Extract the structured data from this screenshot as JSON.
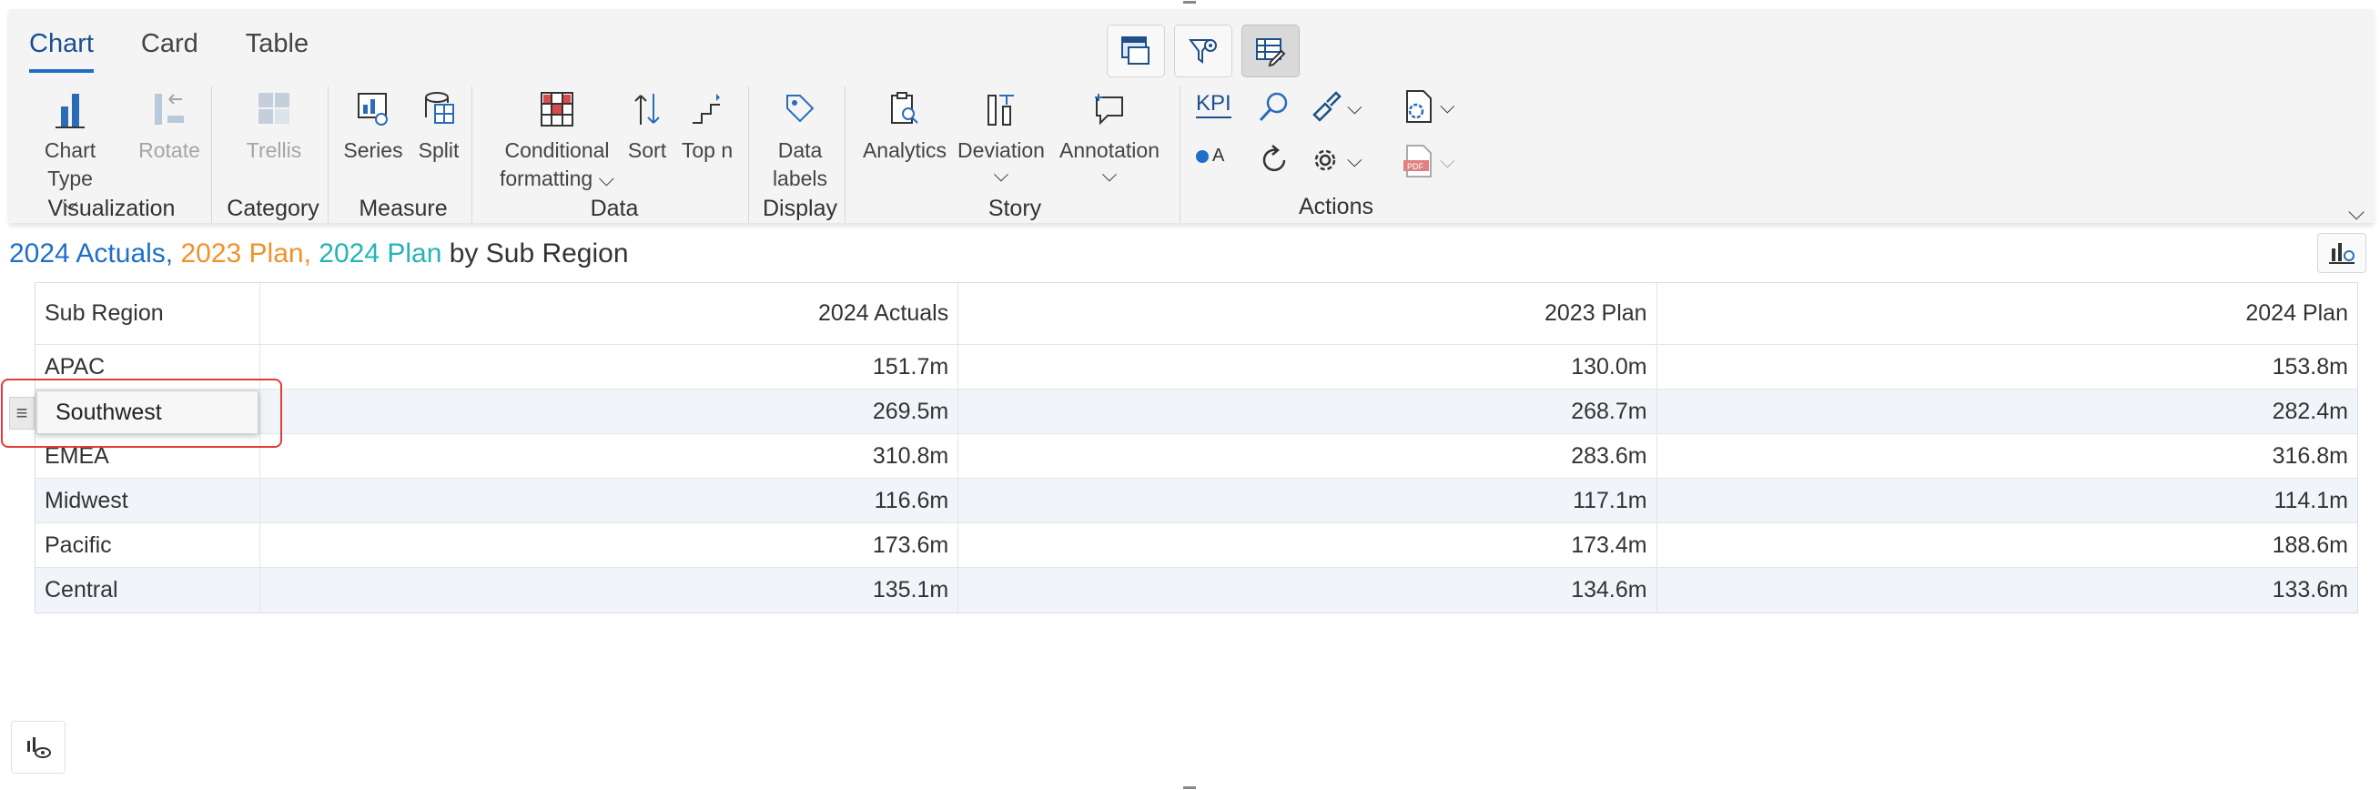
{
  "tabs": [
    {
      "label": "Chart",
      "active": true
    },
    {
      "label": "Card",
      "active": false
    },
    {
      "label": "Table",
      "active": false
    }
  ],
  "ribbon": {
    "visualization": {
      "label": "Visualization",
      "chart_type": "Chart Type",
      "rotate": "Rotate"
    },
    "category": {
      "label": "Category",
      "trellis": "Trellis"
    },
    "measure": {
      "label": "Measure",
      "series": "Series",
      "split": "Split"
    },
    "data": {
      "label": "Data",
      "conditional_1": "Conditional",
      "conditional_2": "formatting",
      "sort": "Sort",
      "topn": "Top n"
    },
    "display": {
      "label": "Display",
      "data_labels_1": "Data",
      "data_labels_2": "labels"
    },
    "story": {
      "label": "Story",
      "analytics": "Analytics",
      "deviation": "Deviation",
      "annotation": "Annotation"
    },
    "actions": {
      "label": "Actions",
      "kpi": "KPI",
      "color_by": "A",
      "pdf": "PDF"
    }
  },
  "title": {
    "part1": "2024 Actuals, ",
    "part2": "2023 Plan, ",
    "part3": "2024 Plan",
    "part4": " by Sub Region"
  },
  "table": {
    "headers": [
      "Sub Region",
      "2024 Actuals",
      "2023 Plan",
      "2024 Plan"
    ],
    "rows": [
      [
        "APAC",
        "151.7m",
        "130.0m",
        "153.8m"
      ],
      [
        "",
        "269.5m",
        "268.7m",
        "282.4m"
      ],
      [
        "EMEA",
        "310.8m",
        "283.6m",
        "316.8m"
      ],
      [
        "Midwest",
        "116.6m",
        "117.1m",
        "114.1m"
      ],
      [
        "Pacific",
        "173.6m",
        "173.4m",
        "188.6m"
      ],
      [
        "Central",
        "135.1m",
        "134.6m",
        "133.6m"
      ]
    ]
  },
  "editor": {
    "value": "Southwest"
  },
  "colors": {
    "accent": "#1e6fc9",
    "series1": "#1e6fc9",
    "series2": "#f0922b",
    "series3": "#26b3b3",
    "highlight": "#e23b3b"
  }
}
